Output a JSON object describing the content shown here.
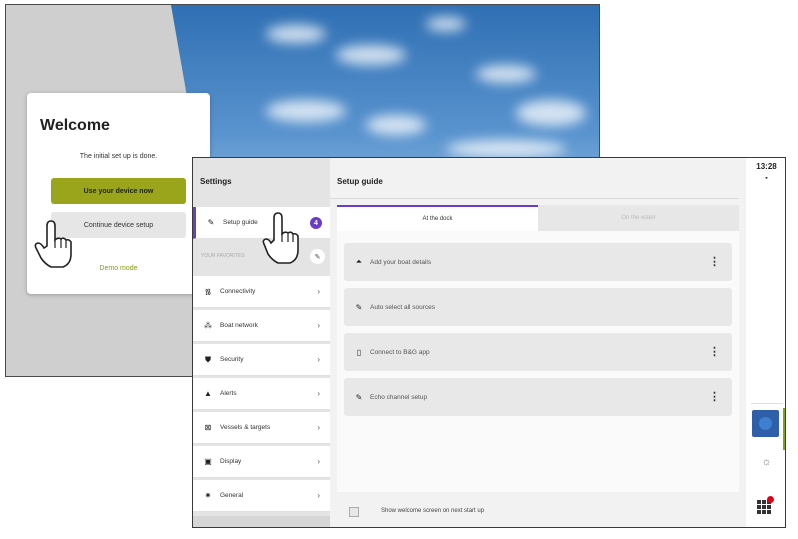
{
  "welcome_screen": {
    "title": "Welcome",
    "subtitle": "The initial set up is done.",
    "use_button": "Use your device now",
    "continue_button": "Continue device setup",
    "demo_link": "Demo mode"
  },
  "settings_screen": {
    "sidebar_title": "Settings",
    "setup_item": {
      "label": "Setup guide",
      "badge": "4",
      "icon": "wrench-icon"
    },
    "section_label": "YOUR FAVORITES",
    "items": [
      {
        "label": "Connectivity",
        "icon": "wifi-icon"
      },
      {
        "label": "Boat network",
        "icon": "network-icon"
      },
      {
        "label": "Security",
        "icon": "shield-icon"
      },
      {
        "label": "Alerts",
        "icon": "alert-icon"
      },
      {
        "label": "Vessels & targets",
        "icon": "vessel-icon"
      },
      {
        "label": "Display",
        "icon": "display-icon"
      },
      {
        "label": "General",
        "icon": "gear-icon"
      }
    ],
    "main_title": "Setup guide",
    "tabs": [
      "At the dock",
      "On the water"
    ],
    "cards": [
      {
        "label": "Add your boat details",
        "icon": "boat-icon",
        "menu": true
      },
      {
        "label": "Auto select all sources",
        "icon": "wrench-icon",
        "menu": false
      },
      {
        "label": "Connect to B&G app",
        "icon": "phone-icon",
        "menu": true
      },
      {
        "label": "Echo channel setup",
        "icon": "wrench-icon",
        "menu": true
      }
    ],
    "footer_text": "Show welcome screen on next start up",
    "clock": "13:28"
  },
  "colors": {
    "accent_purple": "#6a3cc9",
    "button_olive": "#9aa51b",
    "rail_blue": "#2f5fa8",
    "notification_red": "#e1001a"
  }
}
